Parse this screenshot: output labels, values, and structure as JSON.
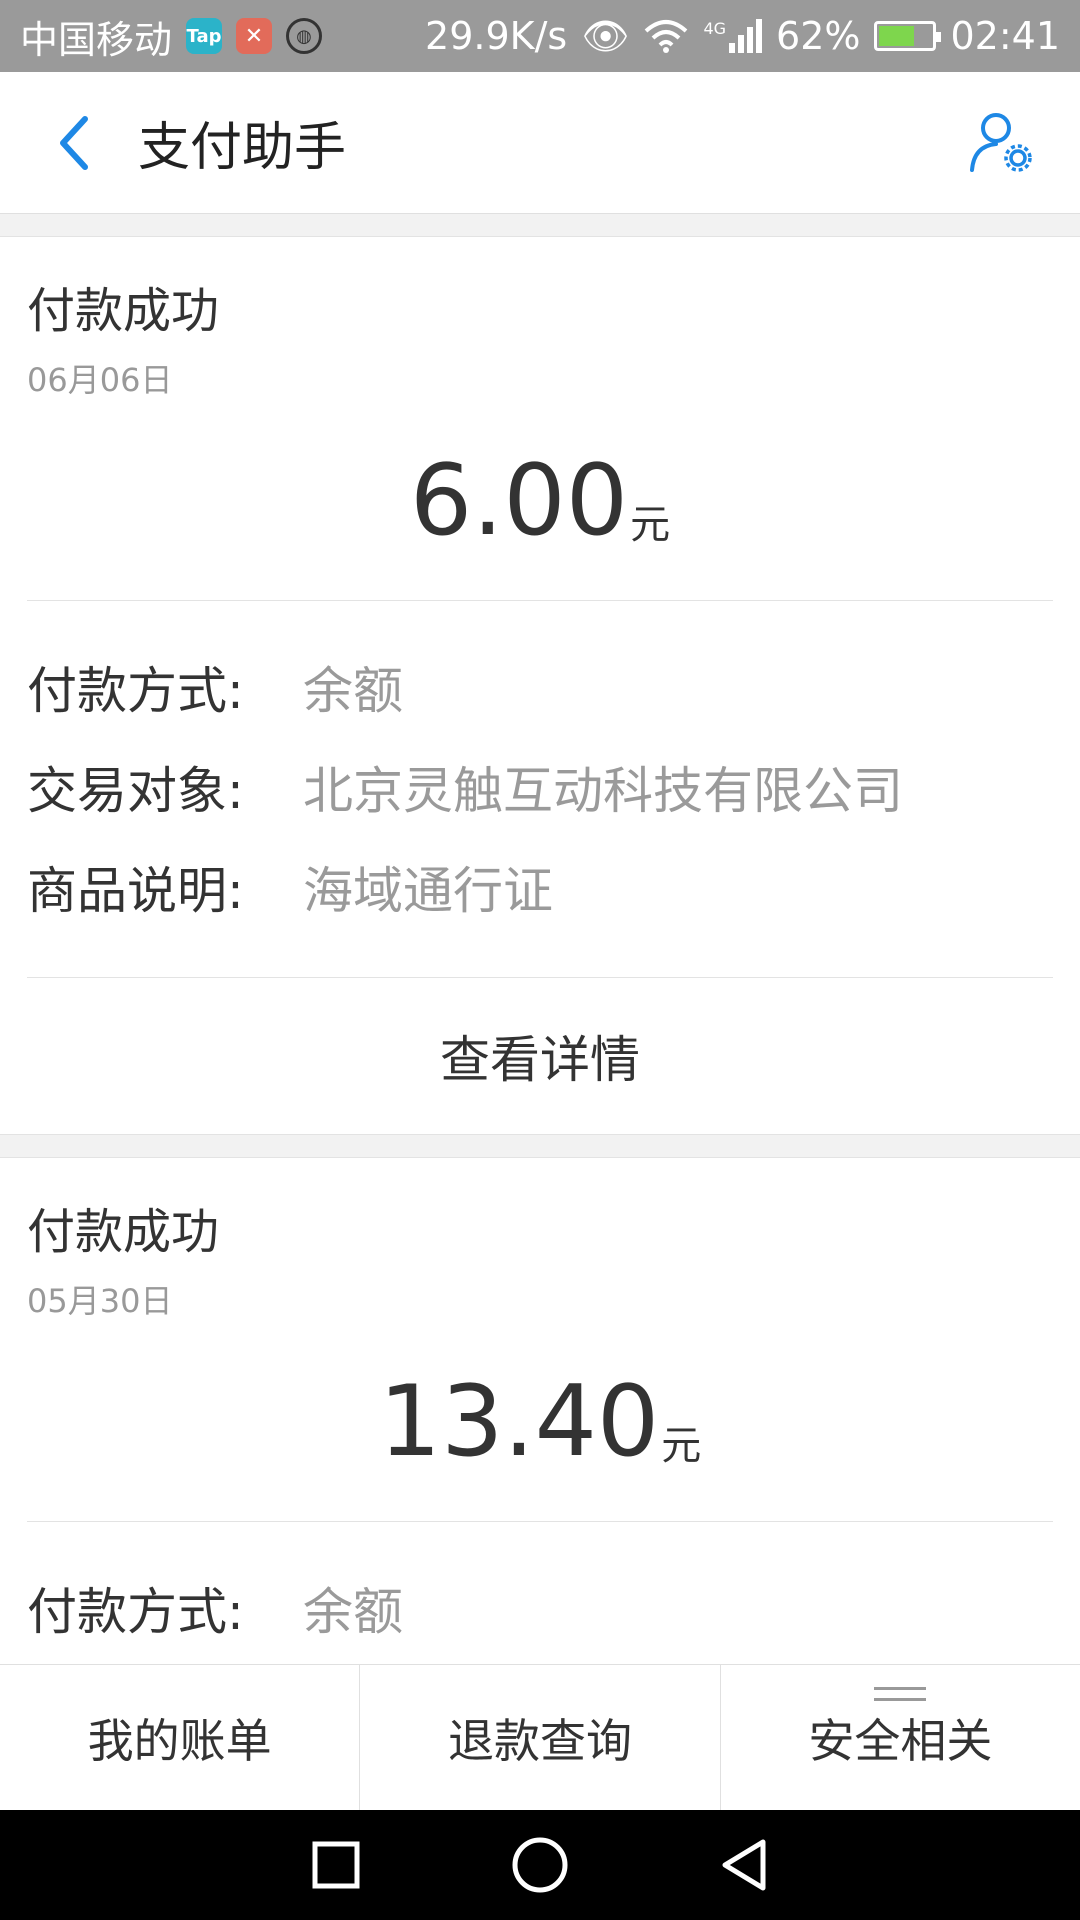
{
  "status_bar": {
    "carrier": "中国移动",
    "app_icon_1": "Tap",
    "speed": "29.9K/s",
    "network": "4G",
    "battery": "62%",
    "time": "02:41"
  },
  "header": {
    "title": "支付助手"
  },
  "transactions": [
    {
      "status": "付款成功",
      "date": "06月06日",
      "amount": "6.00",
      "unit": "元",
      "payment_method_label": "付款方式:",
      "payment_method": "余额",
      "counterparty_label": "交易对象:",
      "counterparty": "北京灵触互动科技有限公司",
      "item_label": "商品说明:",
      "item": "海域通行证",
      "view_details": "查看详情"
    },
    {
      "status": "付款成功",
      "date": "05月30日",
      "amount": "13.40",
      "unit": "元",
      "payment_method_label": "付款方式:",
      "payment_method": "余额"
    }
  ],
  "tabs": [
    {
      "label": "我的账单"
    },
    {
      "label": "退款查询"
    },
    {
      "label": "安全相关"
    }
  ],
  "colors": {
    "accent": "#1e88e5",
    "status_bar": "#9a9a9a"
  }
}
